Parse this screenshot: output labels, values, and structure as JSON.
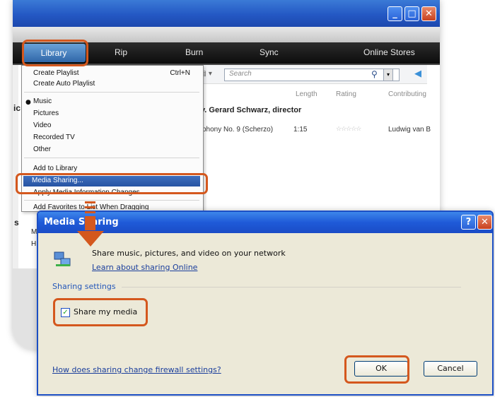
{
  "wmp": {
    "nav_tabs": [
      "Library",
      "Rip",
      "Burn",
      "Sync",
      "Online Stores"
    ],
    "search_placeholder": "Search",
    "columns": [
      "Length",
      "Rating",
      "Contributing"
    ],
    "album_title": "y. Gerard Schwarz, director",
    "track": {
      "title": "phony No. 9 (Scherzo)",
      "length": "1:15",
      "artist": "Ludwig van B"
    },
    "left_stubs": [
      "ic",
      "s",
      "M",
      "H"
    ],
    "window_buttons": {
      "minimize": "_",
      "maximize": "□",
      "close": "✕"
    }
  },
  "library_menu": {
    "items": [
      {
        "label": "Create Playlist",
        "shortcut": "Ctrl+N"
      },
      {
        "label": "Create Auto Playlist"
      },
      {
        "label": "Music",
        "checked": true
      },
      {
        "label": "Pictures"
      },
      {
        "label": "Video"
      },
      {
        "label": "Recorded TV"
      },
      {
        "label": "Other"
      },
      {
        "label": "Add to Library"
      },
      {
        "label": "Media Sharing..."
      },
      {
        "label": "Apply Media Information Changes"
      },
      {
        "label": "Add Favorites to List When Dragging"
      }
    ]
  },
  "dialog": {
    "title": "Media Sharing",
    "description": "Share music, pictures, and video on your network",
    "learn_link": "Learn about sharing Online",
    "group_label": "Sharing settings",
    "checkbox_label": "Share my media",
    "checkbox_checked": true,
    "firewall_link": "How does sharing change firewall settings?",
    "ok_label": "OK",
    "cancel_label": "Cancel",
    "help_symbol": "?",
    "close_symbol": "✕"
  },
  "accent_color": "#d4581e"
}
